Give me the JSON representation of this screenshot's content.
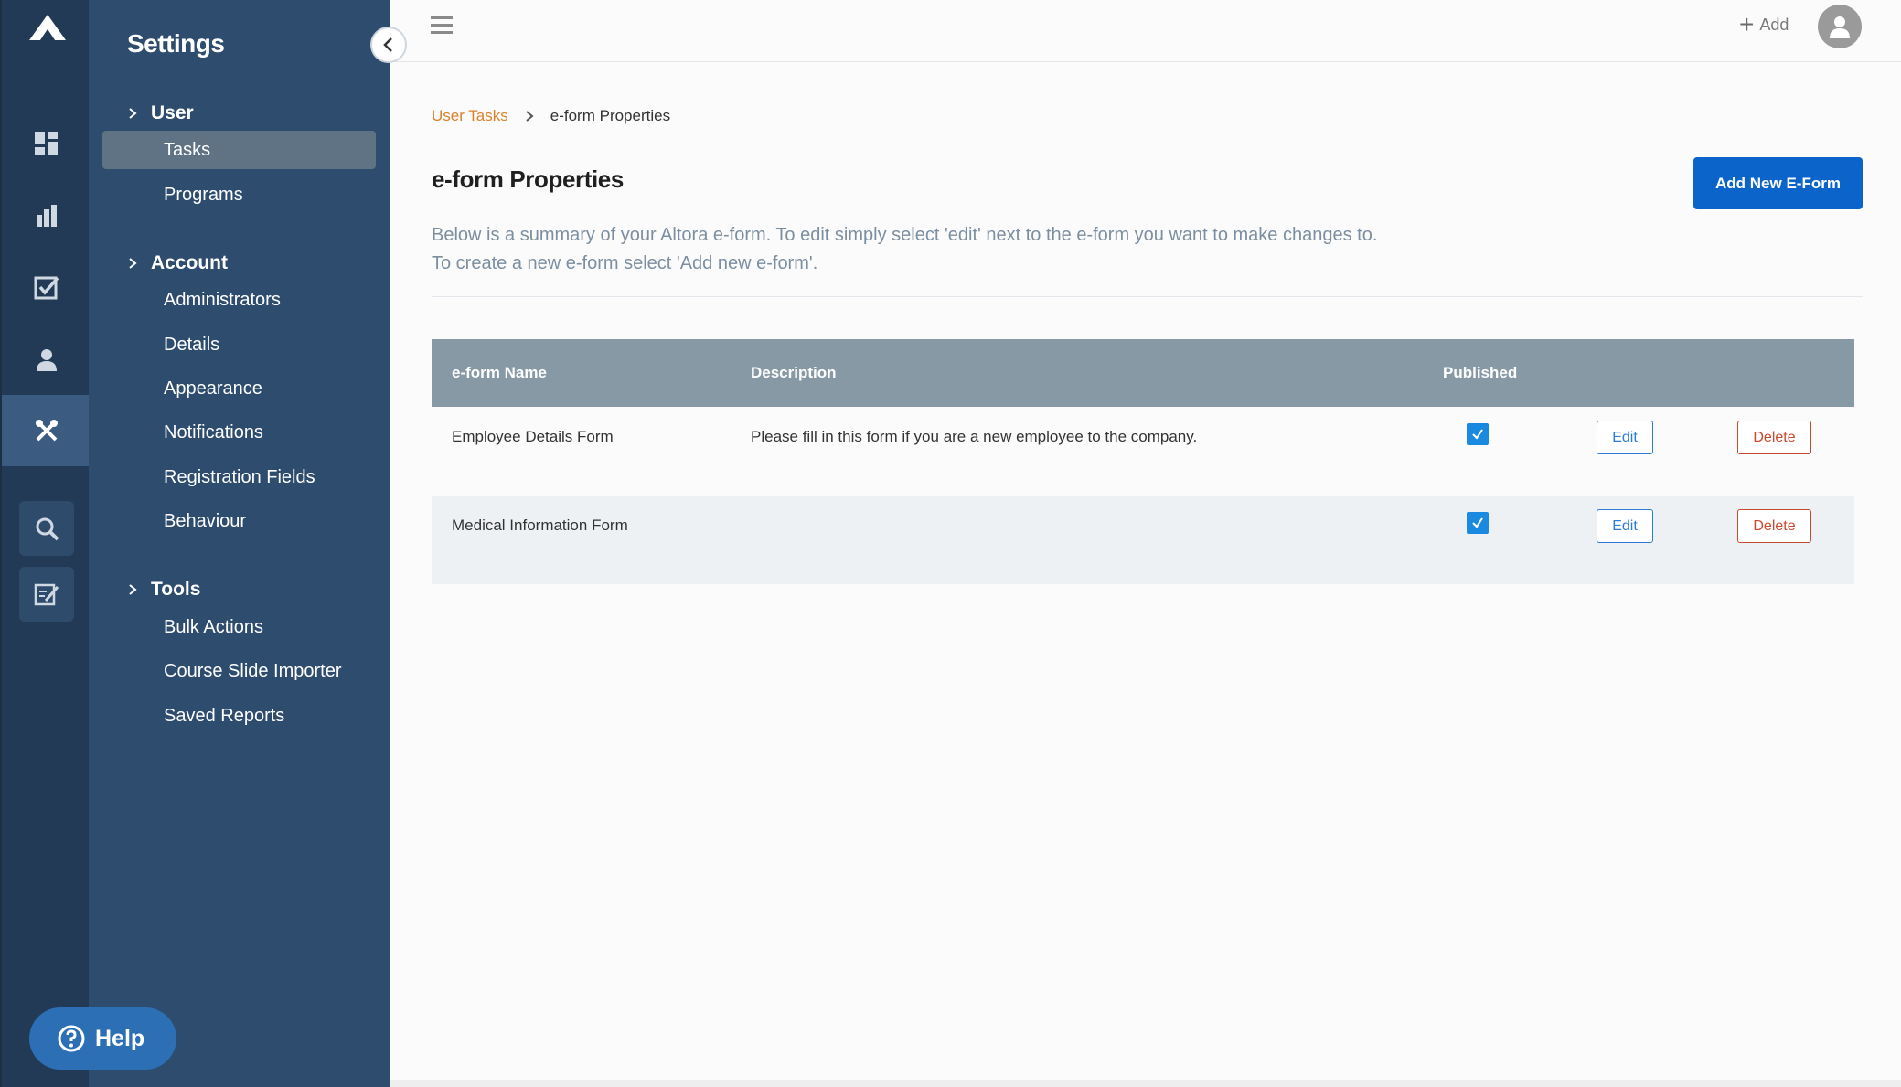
{
  "settings": {
    "title": "Settings",
    "sections": [
      {
        "label": "User",
        "items": [
          "Tasks",
          "Programs"
        ]
      },
      {
        "label": "Account",
        "items": [
          "Administrators",
          "Details",
          "Appearance",
          "Notifications",
          "Registration Fields",
          "Behaviour"
        ]
      },
      {
        "label": "Tools",
        "items": [
          "Bulk Actions",
          "Course Slide Importer",
          "Saved Reports"
        ]
      }
    ],
    "active_item": "Tasks"
  },
  "rail": {
    "icons": [
      "logo-icon",
      "dashboard-icon",
      "reports-icon",
      "tasks-check-icon",
      "user-icon",
      "settings-tools-icon",
      "search-icon",
      "edit-document-icon"
    ],
    "active": "settings-tools-icon"
  },
  "help": {
    "label": "Help"
  },
  "topbar": {
    "add_label": "Add"
  },
  "breadcrumb": {
    "link": "User Tasks",
    "current": "e-form Properties"
  },
  "page": {
    "title": "e-form Properties",
    "add_button": "Add New E-Form",
    "description_line1": "Below is a summary of your Altora e-form. To edit simply select 'edit' next to the e-form you want to make changes to.",
    "description_line2": "To create a new e-form select 'Add new e-form'."
  },
  "table": {
    "headers": {
      "name": "e-form Name",
      "description": "Description",
      "published": "Published"
    },
    "rows": [
      {
        "name": "Employee Details Form",
        "description": "Please fill in this form if you are a new employee to the company.",
        "published": true,
        "edit": "Edit",
        "delete": "Delete"
      },
      {
        "name": "Medical Information Form",
        "description": "",
        "published": true,
        "edit": "Edit",
        "delete": "Delete"
      }
    ]
  },
  "colors": {
    "rail_bg": "#223a56",
    "panel_bg": "#2e4c6e",
    "primary": "#0a64c9",
    "breadcrumb_link": "#d9822b",
    "danger": "#c9492c",
    "table_header": "#8899a6"
  }
}
